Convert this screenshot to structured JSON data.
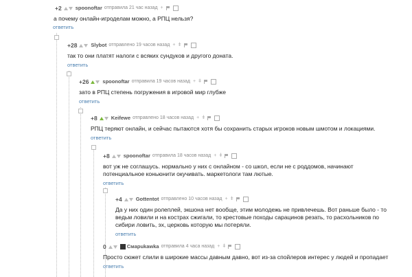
{
  "icons": {
    "plus": "plus-icon",
    "user": "user-icon",
    "link": "link-icon",
    "save": "save-icon"
  },
  "comments": [
    {
      "score": "+2",
      "author": "spoonoftar",
      "time": "отправила 21 час назад",
      "text": [
        "а почему онлайн-игроделам можно, а РПЦ нельзя?"
      ],
      "reply": "ответить"
    },
    {
      "score": "+28",
      "author": "Slybot",
      "time": "отправлено 19 часов назад",
      "text": [
        "так то они платят налоги с всяких сундуков и другого доната."
      ],
      "reply": "ответить"
    },
    {
      "score": "+26",
      "author": "spoonoftar",
      "time": "отправила 19 часов назад",
      "text": [
        "зато в РПЦ степень погружения в игровой мир глубже"
      ],
      "reply": "ответить"
    },
    {
      "score": "+8",
      "author": "Keifewe",
      "time": "отправлено 18 часов назад",
      "text": [
        "РПЦ теряют онлайн, и сейчас пытаются хотя бы сохранить старых игроков новым шмотом и локациями."
      ],
      "reply": "ответить"
    },
    {
      "score": "+8",
      "author": "spoonoftar",
      "time": "отправила 18 часов назад",
      "text": [
        "вот уж не соглашусь. нормально у них с онлайном - со школ, если не с роддомов, начинают",
        "потенциальное коньюнити окучивать. маркетологи там лютые."
      ],
      "reply": "ответить"
    },
    {
      "score": "+4",
      "author": "Gottentot",
      "time": "отправлено 10 часов назад",
      "text": [
        "Да у них один ролеплей, экшона нет вообще, этим молодежь не привлечешь. Вот раньше было - то",
        "ведьм ловили и на кострах сжигали, то крестовые походы сарацинов резать, то расхольников по",
        "сибири ловить, эх, церковь которую мы потеряли."
      ],
      "reply": "ответить"
    },
    {
      "score": "0",
      "author": "Cмapukawka",
      "time": "отправила 4 часа назад",
      "text": [
        "Просто сюжет слили в широкие массы давным давно, вот из-за спойлеров интерес у людей и пропадает"
      ],
      "reply": "ответить"
    }
  ]
}
